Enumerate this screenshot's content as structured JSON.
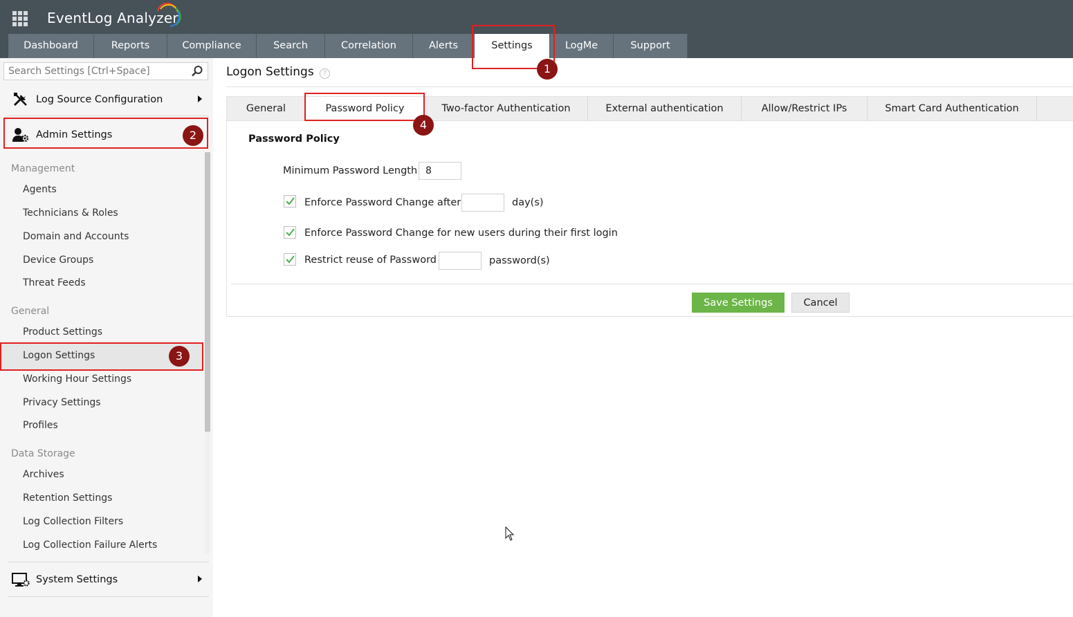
{
  "app": {
    "title": "EventLog Analyzer"
  },
  "nav": {
    "tabs": [
      {
        "label": "Dashboard"
      },
      {
        "label": "Reports"
      },
      {
        "label": "Compliance"
      },
      {
        "label": "Search"
      },
      {
        "label": "Correlation"
      },
      {
        "label": "Alerts"
      },
      {
        "label": "Settings"
      },
      {
        "label": "LogMe"
      },
      {
        "label": "Support"
      }
    ],
    "active": "Settings"
  },
  "sidebar": {
    "search_placeholder": "Search Settings [Ctrl+Space]",
    "sections": {
      "log_source": "Log Source Configuration",
      "admin": "Admin Settings",
      "system": "System Settings"
    },
    "groups": {
      "management": {
        "label": "Management",
        "items": [
          "Agents",
          "Technicians & Roles",
          "Domain and Accounts",
          "Device Groups",
          "Threat Feeds"
        ]
      },
      "general": {
        "label": "General",
        "items": [
          "Product Settings",
          "Logon Settings",
          "Working Hour Settings",
          "Privacy Settings",
          "Profiles"
        ]
      },
      "data_storage": {
        "label": "Data Storage",
        "items": [
          "Archives",
          "Retention Settings",
          "Log Collection Filters",
          "Log Collection Failure Alerts"
        ]
      }
    },
    "selected": "Logon Settings"
  },
  "main": {
    "title": "Logon Settings",
    "help": "?",
    "subtabs": [
      {
        "label": "General"
      },
      {
        "label": "Password Policy"
      },
      {
        "label": "Two-factor Authentication"
      },
      {
        "label": "External authentication"
      },
      {
        "label": "Allow/Restrict IPs"
      },
      {
        "label": "Smart Card Authentication"
      }
    ],
    "active_subtab": "Password Policy",
    "form": {
      "heading": "Password Policy",
      "min_length_label": "Minimum Password Length",
      "min_length_value": "8",
      "enforce_change_label": "Enforce Password Change after",
      "enforce_change_value": "",
      "enforce_change_unit": "day(s)",
      "enforce_change_checked": true,
      "enforce_first_login_label": "Enforce Password Change for new users during their first login",
      "enforce_first_login_checked": true,
      "restrict_reuse_label": "Restrict reuse of Password",
      "restrict_reuse_value": "",
      "restrict_reuse_unit": "password(s)",
      "restrict_reuse_checked": true
    },
    "buttons": {
      "save": "Save Settings",
      "cancel": "Cancel"
    }
  },
  "callouts": [
    "1",
    "2",
    "3",
    "4"
  ],
  "colors": {
    "header_bg": "#475158",
    "tab_bg": "#66737c",
    "save_green": "#6cb548",
    "highlight_red": "#e02020",
    "badge": "#8b1414"
  }
}
